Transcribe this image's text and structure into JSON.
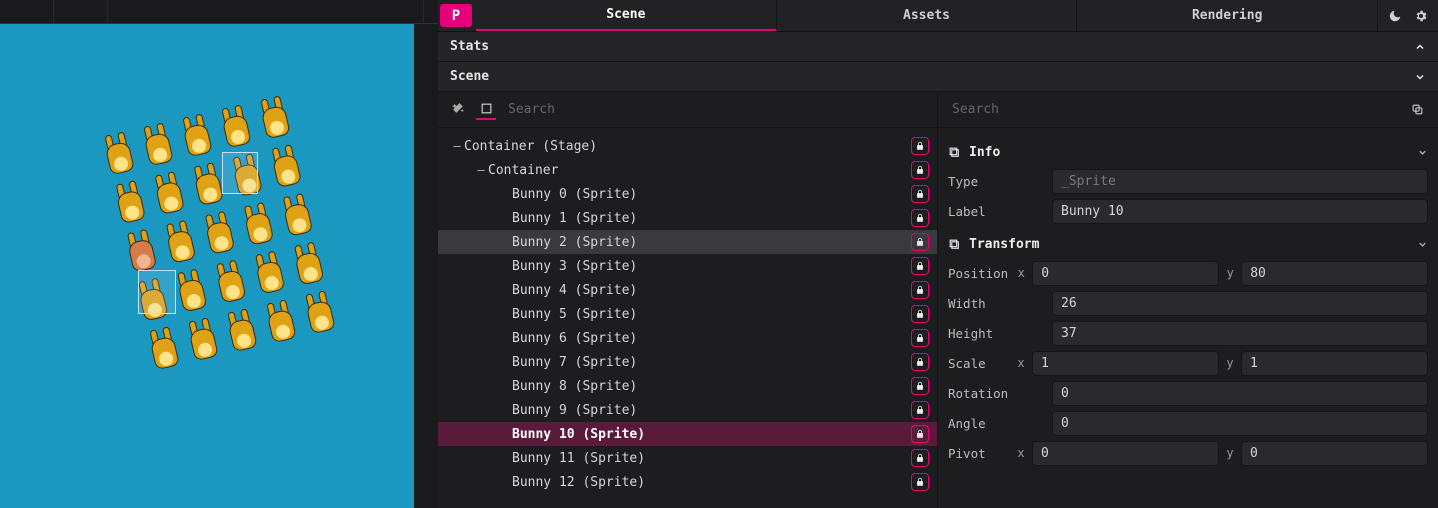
{
  "tabs": {
    "scene": "Scene",
    "assets": "Assets",
    "rendering": "Rendering"
  },
  "sections": {
    "stats": "Stats",
    "scene": "Scene"
  },
  "search_placeholder": "Search",
  "tree": {
    "root": {
      "label": "Container (Stage)"
    },
    "container": {
      "label": "Container"
    },
    "items": [
      {
        "label": "Bunny 0 (Sprite)"
      },
      {
        "label": "Bunny 1 (Sprite)"
      },
      {
        "label": "Bunny 2 (Sprite)"
      },
      {
        "label": "Bunny 3 (Sprite)"
      },
      {
        "label": "Bunny 4 (Sprite)"
      },
      {
        "label": "Bunny 5 (Sprite)"
      },
      {
        "label": "Bunny 6 (Sprite)"
      },
      {
        "label": "Bunny 7 (Sprite)"
      },
      {
        "label": "Bunny 8 (Sprite)"
      },
      {
        "label": "Bunny 9 (Sprite)"
      },
      {
        "label": "Bunny 10 (Sprite)"
      },
      {
        "label": "Bunny 11 (Sprite)"
      },
      {
        "label": "Bunny 12 (Sprite)"
      }
    ],
    "hovered_index": 2,
    "selected_index": 10
  },
  "props": {
    "info": {
      "title": "Info",
      "type_label": "Type",
      "type_value": "_Sprite",
      "label_label": "Label",
      "label_value": "Bunny 10"
    },
    "transform": {
      "title": "Transform",
      "position_label": "Position",
      "position_x": "0",
      "position_y": "80",
      "width_label": "Width",
      "width_value": "26",
      "height_label": "Height",
      "height_value": "37",
      "scale_label": "Scale",
      "scale_x": "1",
      "scale_y": "1",
      "rotation_label": "Rotation",
      "rotation_value": "0",
      "angle_label": "Angle",
      "angle_value": "0",
      "pivot_label": "Pivot",
      "pivot_x": "0",
      "pivot_y": "0"
    },
    "xy": {
      "x": "x",
      "y": "y"
    }
  },
  "colors": {
    "accent": "#e6007a",
    "canvas": "#1a98c0"
  }
}
